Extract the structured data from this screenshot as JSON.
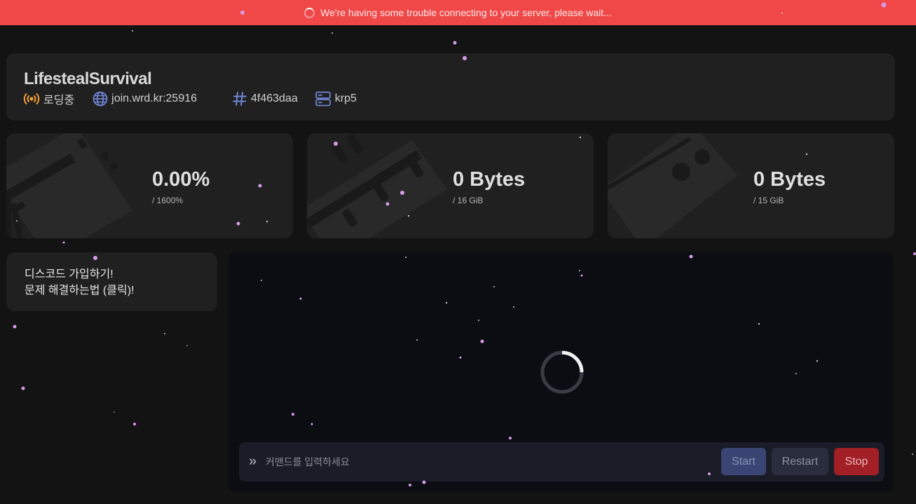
{
  "banner": {
    "message": "We're having some trouble connecting to your server, please wait...",
    "color": "#f04848"
  },
  "server": {
    "name": "LifestealSurvival",
    "status": "로딩중",
    "status_icon": "broadcast-icon",
    "status_color": "#f4a032",
    "address": "join.wrd.kr:25916",
    "address_icon": "globe-icon",
    "id": "4f463daa",
    "id_icon": "hash-icon",
    "node": "krp5",
    "node_icon": "server-stack-icon",
    "icon_color": "#6f86d6"
  },
  "stats": {
    "cpu": {
      "value": "0.00%",
      "limit": "/ 1600%",
      "icon": "cpu-chip-icon"
    },
    "memory": {
      "value": "0 Bytes",
      "limit": "/ 16 GiB",
      "icon": "memory-stick-icon"
    },
    "disk": {
      "value": "0 Bytes",
      "limit": "/ 15 GiB",
      "icon": "hard-drive-icon"
    }
  },
  "links": {
    "discord": "디스코드 가입하기!",
    "troubleshoot": "문제 해결하는법 (클릭)!"
  },
  "console": {
    "prompt_icon": "chevron-double-right-icon",
    "placeholder": "커맨드를 입력하세요",
    "start_label": "Start",
    "restart_label": "Restart",
    "stop_label": "Stop"
  }
}
